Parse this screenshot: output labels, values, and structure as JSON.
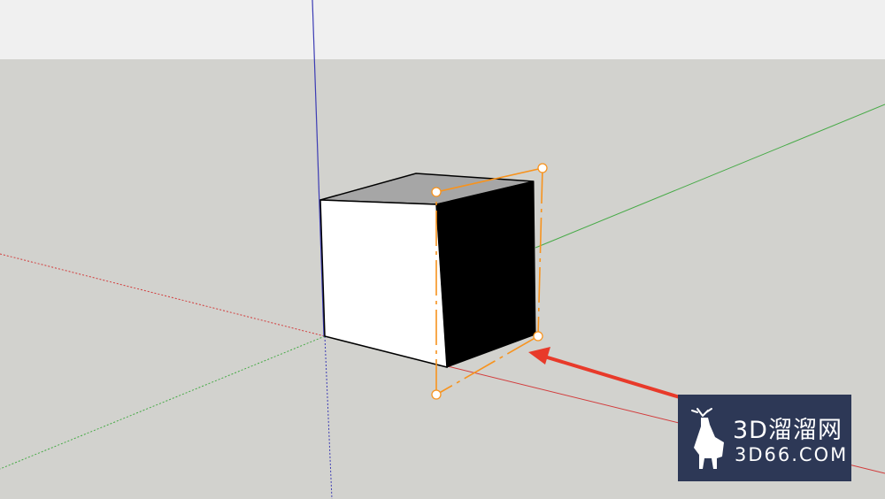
{
  "viewport": {
    "sky_color": "#f0f0f0",
    "ground_color": "#d2d2ce",
    "axis_colors": {
      "red": "#d23c3c",
      "green": "#46aa46",
      "blue": "#3c3cb4"
    }
  },
  "model": {
    "face_front_color": "#ffffff",
    "face_top_color": "#a6a6a6",
    "face_right_color": "#000000",
    "selection_color": "#f7931e"
  },
  "annotation": {
    "arrow_color": "#e83a2a"
  },
  "watermark": {
    "title": "3D溜溜网",
    "url": "3D66.COM",
    "bg_color": "#2d3856",
    "logo_icon": "deer-logo-icon"
  }
}
